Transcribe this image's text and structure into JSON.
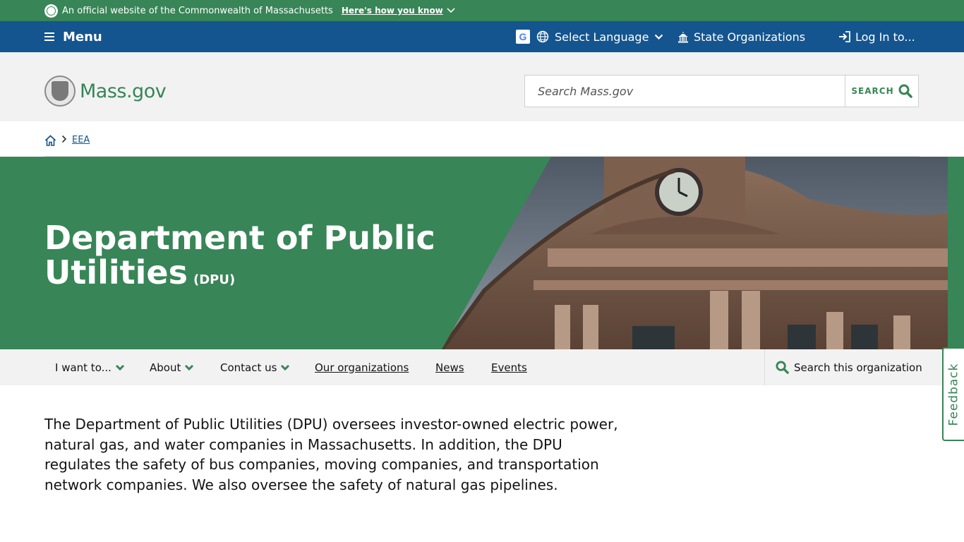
{
  "official_bar": {
    "text": "An official website of the Commonwealth of Massachusetts",
    "how_link": "Here's how you know"
  },
  "utility_nav": {
    "menu_label": "Menu",
    "language_label": "Select Language",
    "state_orgs_label": "State Organizations",
    "login_label": "Log In to..."
  },
  "header": {
    "logo_text": "Mass.gov",
    "search_placeholder": "Search Mass.gov",
    "search_button": "SEARCH"
  },
  "breadcrumb": {
    "items": [
      "EEA"
    ]
  },
  "hero": {
    "title": "Department of Public Utilities",
    "acronym": "(DPU)"
  },
  "org_nav": {
    "items": [
      {
        "label": "I want to...",
        "dropdown": true
      },
      {
        "label": "About",
        "dropdown": true
      },
      {
        "label": "Contact us",
        "dropdown": true
      },
      {
        "label": "Our organizations",
        "dropdown": false
      },
      {
        "label": "News",
        "dropdown": false
      },
      {
        "label": "Events",
        "dropdown": false
      }
    ],
    "search_label": "Search this organization"
  },
  "feedback_label": "Feedback",
  "intro_text": "The Department of Public Utilities (DPU) oversees investor-owned electric power, natural gas, and water companies in Massachusetts. In addition, the DPU regulates the safety of bus companies, moving companies, and transportation network companies. We also oversee the safety of natural gas pipelines.",
  "colors": {
    "brand_green": "#388557",
    "nav_blue": "#14558f",
    "header_gray": "#f2f2f2"
  },
  "icons": [
    "seal-icon",
    "chevron-down-icon",
    "hamburger-icon",
    "google-translate-icon",
    "globe-icon",
    "capitol-building-icon",
    "login-icon",
    "search-icon",
    "home-icon",
    "chevron-right-icon"
  ]
}
